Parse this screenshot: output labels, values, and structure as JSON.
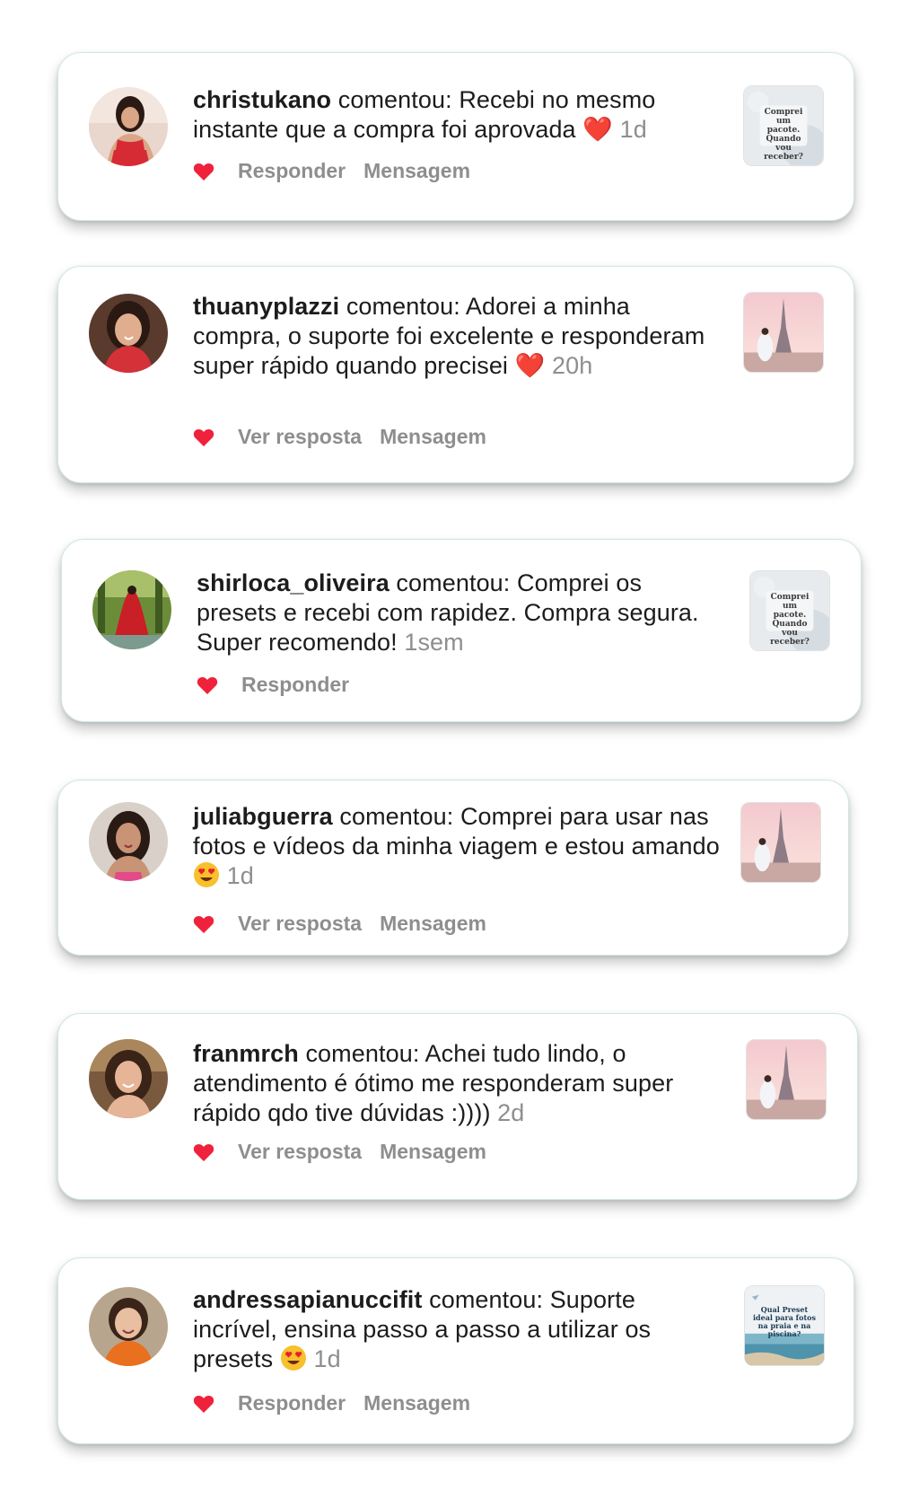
{
  "comments": [
    {
      "username": "christukano",
      "verb": " comentou: ",
      "text": "Recebi no mesmo instante que a compra foi aprovada ",
      "emoji": "❤️",
      "time": "1d",
      "actions": [
        "Responder",
        "Mensagem"
      ],
      "thumb_text": "Comprei um pacote. Quando vou receber?"
    },
    {
      "username": "thuanyplazzi",
      "verb": " comentou: ",
      "text": "Adorei a minha compra, o suporte foi excelente e responderam super rápido quando precisei ",
      "emoji": "❤️",
      "time": "20h",
      "actions": [
        "Ver resposta",
        "Mensagem"
      ]
    },
    {
      "username": "shirloca_oliveira",
      "verb": " comentou: ",
      "text": "Comprei os presets e recebi com rapidez. Compra segura. Super recomendo! ",
      "time": "1sem",
      "actions": [
        "Responder"
      ],
      "thumb_text": "Comprei um pacote. Quando vou receber?"
    },
    {
      "username": "juliabguerra",
      "verb": " comentou: ",
      "text": "Comprei para usar nas fotos e vídeos da minha viagem e estou amando ",
      "emoji": "😍",
      "time": "1d",
      "actions": [
        "Ver resposta",
        "Mensagem"
      ]
    },
    {
      "username": "franmrch",
      "verb": " comentou: ",
      "text": "Achei tudo lindo, o atendimento é ótimo me responderam super rápido qdo tive dúvidas :)))) ",
      "time": "2d",
      "actions": [
        "Ver resposta",
        "Mensagem"
      ]
    },
    {
      "username": "andressapianuccifit",
      "verb": " comentou: ",
      "text": "Suporte incrível, ensina passo a passo a utilizar os presets ",
      "emoji": "😍",
      "time": "1d",
      "actions": [
        "Responder",
        "Mensagem"
      ],
      "thumb_text": "Qual Preset ideal para fotos na praia e na piscina?"
    }
  ],
  "colors": {
    "heart": "#f0213a",
    "muted": "#8e8e8e",
    "text": "#1c1c1c",
    "card_border": "#cfe7ea"
  }
}
